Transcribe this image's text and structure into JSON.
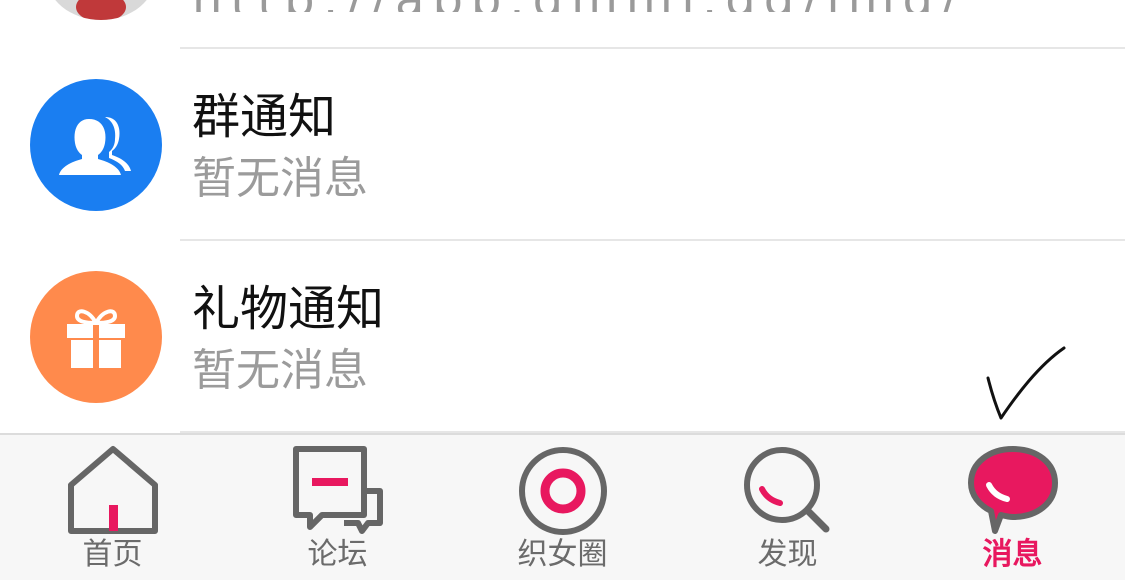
{
  "top_partial": {
    "text": "http://app.qmmf.gg/img/"
  },
  "rows": [
    {
      "title": "群通知",
      "subtitle": "暂无消息",
      "icon": "group-icon",
      "icon_color": "#1a7ef1"
    },
    {
      "title": "礼物通知",
      "subtitle": "暂无消息",
      "icon": "gift-icon",
      "icon_color": "#ff8a4c"
    }
  ],
  "tabbar": {
    "active": "消息",
    "accent_color": "#e8185f",
    "tabs": [
      {
        "label": "首页",
        "icon": "home-icon"
      },
      {
        "label": "论坛",
        "icon": "forum-icon"
      },
      {
        "label": "织女圈",
        "icon": "circle-icon"
      },
      {
        "label": "发现",
        "icon": "search-icon"
      },
      {
        "label": "消息",
        "icon": "message-icon"
      }
    ]
  },
  "annotation": {
    "icon": "checkmark-annotation"
  }
}
